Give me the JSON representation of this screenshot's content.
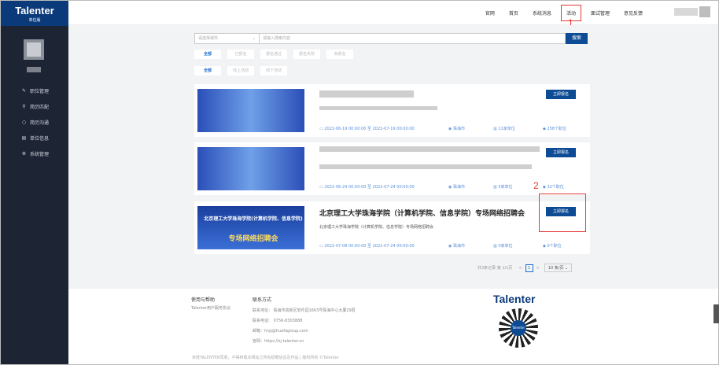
{
  "sidebar": {
    "brand": "Talenter",
    "brand_sub": "单位版",
    "items": [
      {
        "icon": "edit-icon",
        "glyph": "✎",
        "label": "职位管理"
      },
      {
        "icon": "search-icon",
        "glyph": "⚲",
        "label": "简历匹配"
      },
      {
        "icon": "chat-icon",
        "glyph": "○",
        "label": "简历沟通"
      },
      {
        "icon": "document-icon",
        "glyph": "▤",
        "label": "单位信息"
      },
      {
        "icon": "gear-icon",
        "glyph": "⚙",
        "label": "系统管理"
      }
    ]
  },
  "header": {
    "nav": [
      "官网",
      "首页",
      "系统消息",
      "活动",
      "面试管理",
      "意见反馈"
    ],
    "active": "活动"
  },
  "annotations": {
    "one": "1",
    "two": "2"
  },
  "search": {
    "city_placeholder": "请选择城市",
    "keyword_placeholder": "请输入搜索内容",
    "button": "搜索"
  },
  "filters": {
    "status": [
      "全部",
      "已报名",
      "报名通过",
      "报名失败",
      "未报名"
    ],
    "mode": [
      "全部",
      "线上活动",
      "线下活动"
    ]
  },
  "cards": [
    {
      "apply": "立即报名",
      "date": "2022-06-19 00:00:00 至  2022-07-19 00:00:00",
      "city": "珠海市",
      "units": "11家单位",
      "jobs": "258个职位"
    },
    {
      "apply": "立即报名",
      "date": "2022-06-24 00:00:00 至  2022-07-24 00:00:00",
      "city": "珠海市",
      "units": "5家单位",
      "jobs": "32个职位"
    },
    {
      "title": "北京理工大学珠海学院（计算机学院、信息学院）专场网络招聘会",
      "desc": "北京理工大学珠海学院（计算机学院、信息学院）专场网络招聘会",
      "banner_title": "北京理工大学珠海学院(计算机学院、信息学院)",
      "banner_sub": "专场网络招聘会",
      "apply": "立即报名",
      "date": "2022-07-08 00:00:00 至  2022-07-24 00:00:00",
      "city": "珠海市",
      "units": "0家单位",
      "jobs": "0个职位"
    }
  ],
  "pager": {
    "total": "共3条记录 第 1/1页",
    "current": "1",
    "per_page": "10 条/页 ⌄",
    "prev": "<",
    "next": ">"
  },
  "footer": {
    "help_title": "使用与帮助",
    "help_link": "Talenter用户服务协议",
    "contact_title": "联系方式",
    "address": "联系地址： 珠海市高新区软件园1663号珠海中心大厦29层",
    "phone": "联系电话： 0756-8303888",
    "email": "邮箱：hrpj@huafagroup.com",
    "site": "官网：https://sj.talenter.cn",
    "copyright": "未经TALENTER同意，不得转载本网站之所有招聘信息及作品 | 版权所有 ©Talenter",
    "logo": "Talenter",
    "qr_label": "Talenter"
  }
}
